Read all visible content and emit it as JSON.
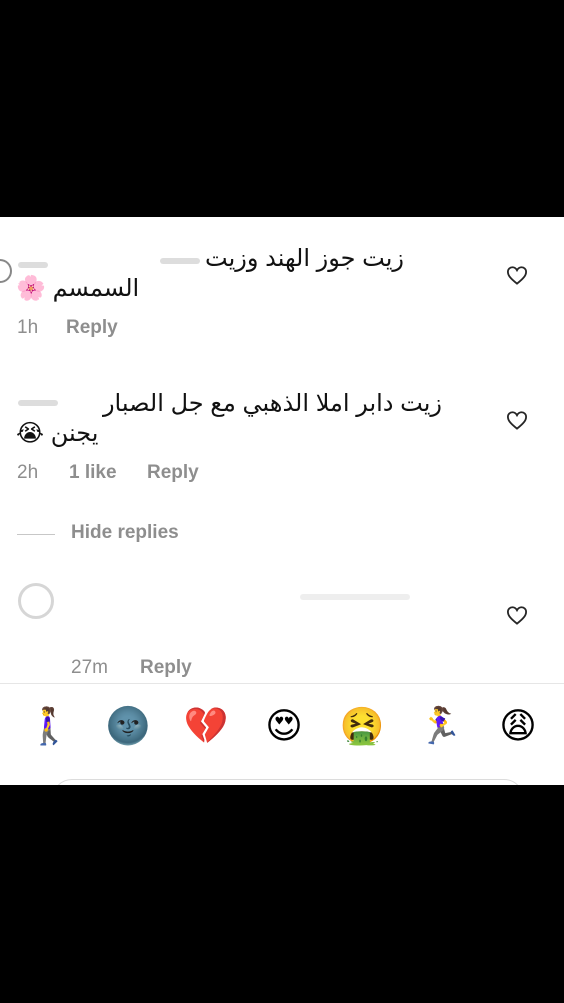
{
  "comments": [
    {
      "line1": "زيت جوز الهند وزيت",
      "line2": "السمسم",
      "line2_emoji": "🌸",
      "time": "1h",
      "reply": "Reply"
    },
    {
      "line1": "زيت دابر املا الذهبي مع جل الصبار",
      "line2": "يجنن",
      "line2_emoji": "😭",
      "time": "2h",
      "likes": "1 like",
      "reply": "Reply"
    }
  ],
  "hide_replies": "Hide replies",
  "reply_comment": {
    "time": "27m",
    "reply": "Reply"
  },
  "emoji_bar": [
    "🚶‍♀️",
    "🌚",
    "💔",
    "😍",
    "🤮",
    "🏃‍♀️",
    "😩"
  ],
  "colors": {
    "meta_text": "#8e8e8e",
    "background_outer": "#000000",
    "panel": "#ffffff"
  }
}
